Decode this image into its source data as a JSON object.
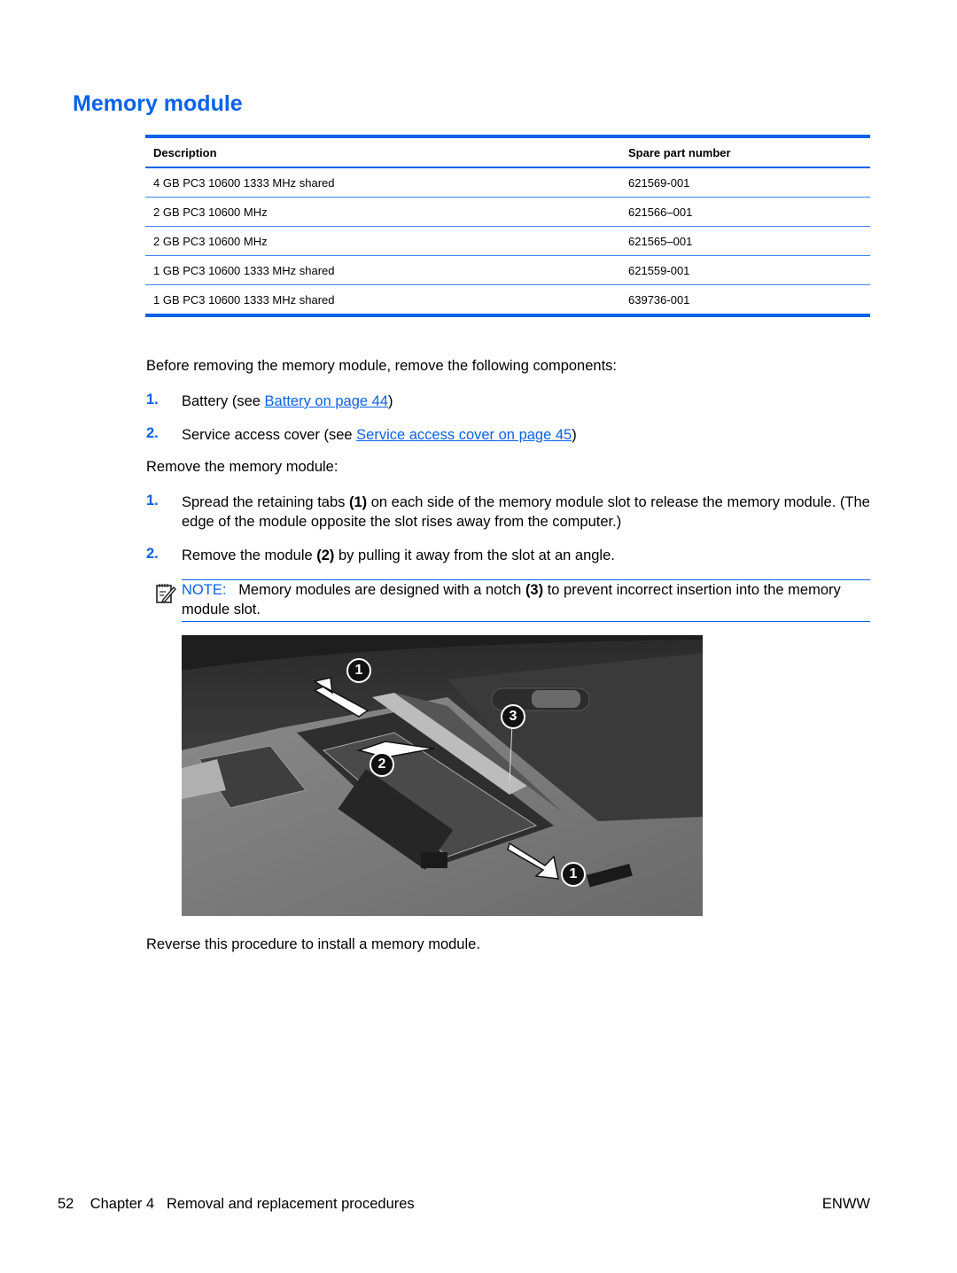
{
  "title": "Memory module",
  "table": {
    "headers": [
      "Description",
      "Spare part number"
    ],
    "rows": [
      [
        "4 GB PC3 10600 1333 MHz shared",
        "621569-001"
      ],
      [
        "2 GB PC3 10600 MHz",
        "621566–001"
      ],
      [
        "2 GB PC3 10600 MHz",
        "621565–001"
      ],
      [
        "1 GB PC3 10600 1333 MHz shared",
        "621559-001"
      ],
      [
        "1 GB PC3 10600 1333 MHz shared",
        "639736-001"
      ]
    ]
  },
  "prereq_intro": "Before removing the memory module, remove the following components:",
  "prereqs": [
    {
      "num": "1.",
      "before": "Battery (see ",
      "link": "Battery on page 44",
      "after": ")"
    },
    {
      "num": "2.",
      "before": "Service access cover (see ",
      "link": "Service access cover on page 45",
      "after": ")"
    }
  ],
  "remove_intro": "Remove the memory module:",
  "steps": [
    {
      "num": "1.",
      "pre": "Spread the retaining tabs ",
      "bold": "(1)",
      "post": " on each side of the memory module slot to release the memory module. (The edge of the module opposite the slot rises away from the computer.)"
    },
    {
      "num": "2.",
      "pre": "Remove the module ",
      "bold": "(2)",
      "post": " by pulling it away from the slot at an angle."
    }
  ],
  "note": {
    "icon": "note-pencil-icon",
    "label": "NOTE:",
    "pre": "Memory modules are designed with a notch ",
    "bold": "(3)",
    "post": " to prevent incorrect insertion into the memory module slot."
  },
  "figure": {
    "callouts": [
      "1",
      "2",
      "3",
      "1"
    ]
  },
  "closing": "Reverse this procedure to install a memory module.",
  "footer": {
    "page_number": "52",
    "chapter": "Chapter 4",
    "chapter_title": "Removal and replacement procedures",
    "locale": "ENWW"
  }
}
